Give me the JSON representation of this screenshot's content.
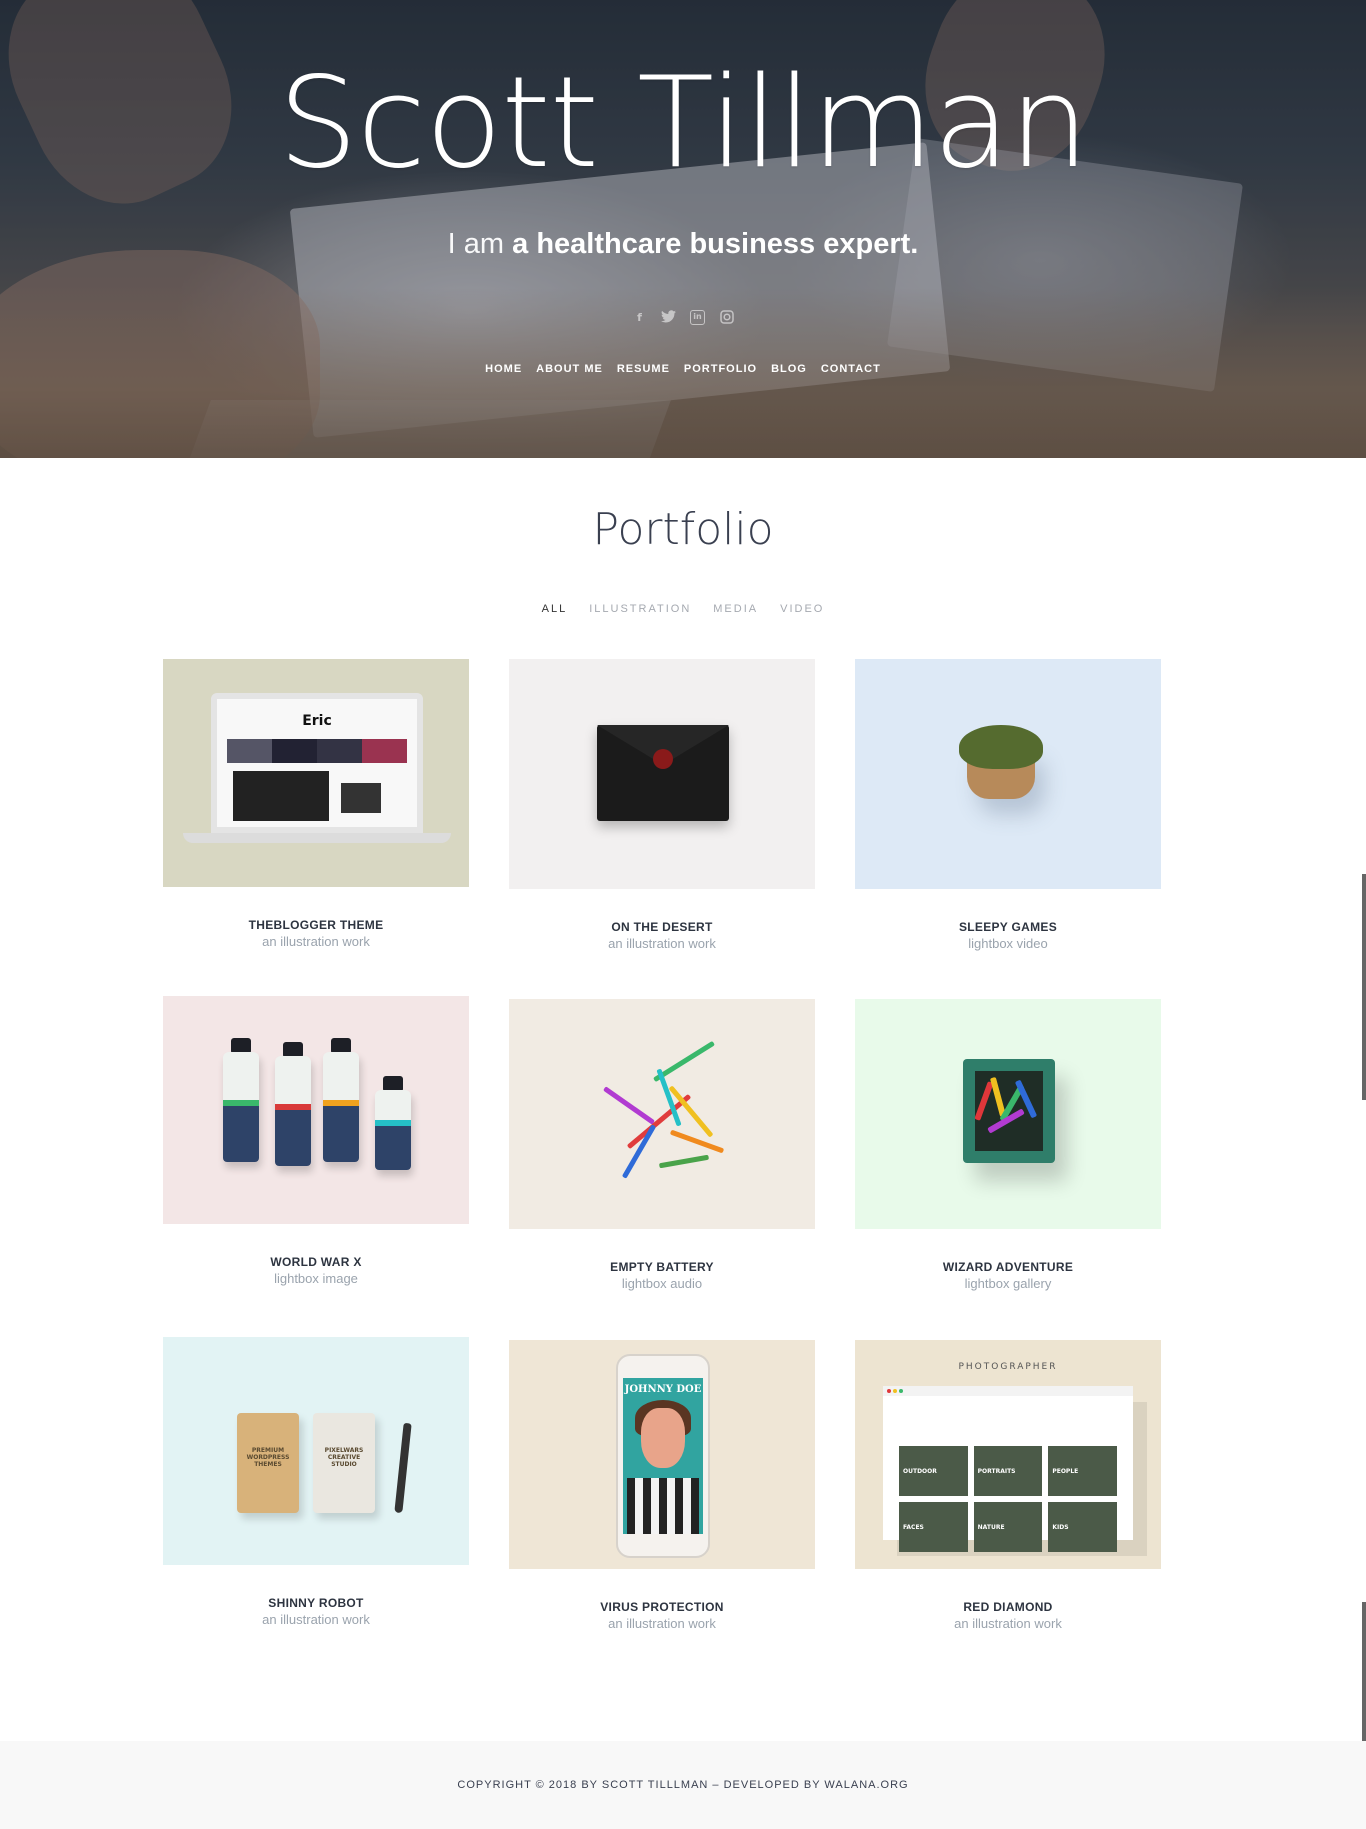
{
  "hero": {
    "name": "Scott Tillman",
    "tagline_prefix": "I am",
    "tagline_strong": "a healthcare business expert.",
    "social_icons": [
      "facebook-icon",
      "twitter-icon",
      "linkedin-icon",
      "instagram-icon"
    ],
    "nav": [
      "HOME",
      "ABOUT ME",
      "RESUME",
      "PORTFOLIO",
      "BLOG",
      "CONTACT"
    ]
  },
  "portfolio": {
    "title": "Portfolio",
    "filters": [
      "ALL",
      "ILLUSTRATION",
      "MEDIA",
      "VIDEO"
    ],
    "active_filter": "ALL",
    "items": [
      {
        "title": "THEBLOGGER THEME",
        "subtitle": "an illustration work",
        "bg": "#d8d7c2",
        "laptop_logo": "Eric"
      },
      {
        "title": "ON THE DESERT",
        "subtitle": "an illustration work",
        "bg": "#f2f0f0"
      },
      {
        "title": "SLEEPY GAMES",
        "subtitle": "lightbox video",
        "bg": "#dde9f6"
      },
      {
        "title": "WORLD WAR X",
        "subtitle": "lightbox image",
        "bg": "#f3e6e6"
      },
      {
        "title": "EMPTY BATTERY",
        "subtitle": "lightbox audio",
        "bg": "#f1ebe3"
      },
      {
        "title": "WIZARD ADVENTURE",
        "subtitle": "lightbox gallery",
        "bg": "#e8faea"
      },
      {
        "title": "SHINNY ROBOT",
        "subtitle": "an illustration work",
        "bg": "#e2f3f4",
        "book_labels": [
          "PREMIUM WORDPRESS THEMES",
          "PIXELWARS CREATIVE STUDIO"
        ]
      },
      {
        "title": "VIRUS PROTECTION",
        "subtitle": "an illustration work",
        "bg": "#efe6d6",
        "phone_headline": "JOHNNY DOE"
      },
      {
        "title": "RED DIAMOND",
        "subtitle": "an illustration work",
        "bg": "#ede4d1",
        "photographer_label": "PHOTOGRAPHER",
        "gallery_labels": [
          "OUTDOOR",
          "PORTRAITS",
          "PEOPLE",
          "FACES",
          "NATURE",
          "KIDS"
        ]
      }
    ]
  },
  "footer": {
    "text": "COPYRIGHT © 2018 BY SCOTT TILLLMAN – DEVELOPED BY WALANA.ORG"
  }
}
